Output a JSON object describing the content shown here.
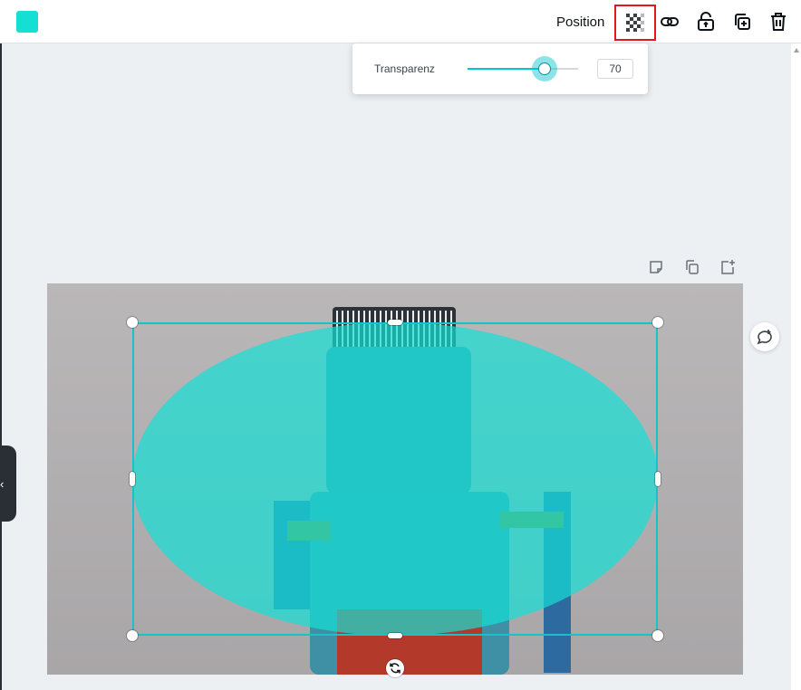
{
  "toolbar": {
    "color_swatch": "#14dfd5",
    "position_label": "Position",
    "icons": [
      "transparency-icon",
      "link-icon",
      "unlock-icon",
      "duplicate-icon",
      "trash-icon"
    ]
  },
  "transparency_popover": {
    "label": "Transparenz",
    "value": "70",
    "value_percent": 70
  },
  "page_actions": [
    "note-icon",
    "copy-page-icon",
    "add-page-icon"
  ],
  "colors": {
    "accent": "#00c4cc",
    "shape_fill": "#14dfd5",
    "highlight_border": "#e1191d"
  },
  "element": {
    "type": "ellipse",
    "opacity_percent": 70
  }
}
